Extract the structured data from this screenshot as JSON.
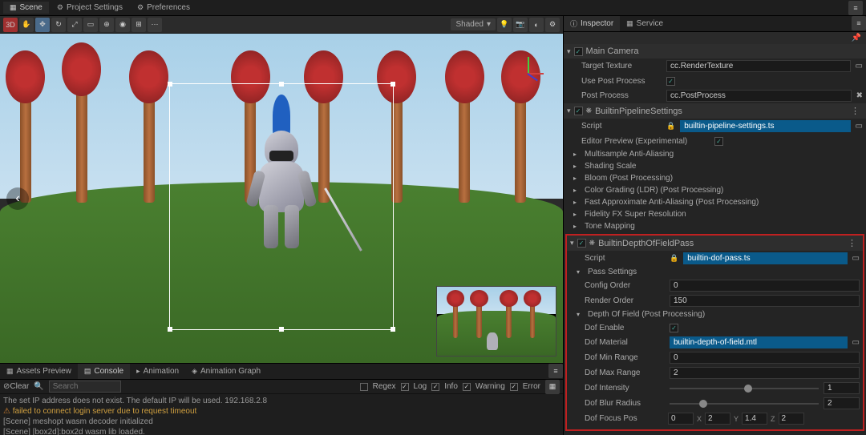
{
  "topTabs": {
    "scene": "Scene",
    "projectSettings": "Project Settings",
    "preferences": "Preferences"
  },
  "viewportToolbar": {
    "mode3d": "3D",
    "shaded": "Shaded"
  },
  "bottomTabs": {
    "assetsPreview": "Assets Preview",
    "console": "Console",
    "animation": "Animation",
    "animationGraph": "Animation Graph"
  },
  "consoleToolbar": {
    "clear": "Clear",
    "searchPlaceholder": "Search",
    "regex": "Regex",
    "log": "Log",
    "info": "Info",
    "warning": "Warning",
    "error": "Error"
  },
  "consoleLines": [
    {
      "type": "info",
      "text": "The set IP address does not exist. The default IP will be used. 192.168.2.8"
    },
    {
      "type": "warn",
      "text": "failed to connect login server due to request timeout"
    },
    {
      "type": "info",
      "text": "[Scene] meshopt wasm decoder initialized"
    },
    {
      "type": "info",
      "text": "[Scene] [box2d]:box2d wasm lib loaded."
    }
  ],
  "inspector": {
    "tabInspector": "Inspector",
    "tabService": "Service",
    "node": "Main Camera",
    "targetTextureLabel": "Target Texture",
    "targetTextureValue": "cc.RenderTexture",
    "usePostProcessLabel": "Use Post Process",
    "postProcessLabel": "Post Process",
    "postProcessValue": "cc.PostProcess",
    "builtinPipeline": {
      "title": "BuiltinPipelineSettings",
      "scriptLabel": "Script",
      "scriptValue": "builtin-pipeline-settings.ts",
      "editorPreviewLabel": "Editor Preview (Experimental)",
      "rows": [
        "Multisample Anti-Aliasing",
        "Shading Scale",
        "Bloom (Post Processing)",
        "Color Grading (LDR) (Post Processing)",
        "Fast Approximate Anti-Aliasing (Post Processing)",
        "Fidelity FX Super Resolution",
        "Tone Mapping"
      ]
    },
    "dofPass": {
      "title": "BuiltinDepthOfFieldPass",
      "scriptLabel": "Script",
      "scriptValue": "builtin-dof-pass.ts",
      "passSettingsLabel": "Pass Settings",
      "configOrderLabel": "Config Order",
      "configOrderValue": "0",
      "renderOrderLabel": "Render Order",
      "renderOrderValue": "150",
      "dofSectionLabel": "Depth Of Field (Post Processing)",
      "dofEnableLabel": "Dof Enable",
      "dofMaterialLabel": "Dof Material",
      "dofMaterialValue": "builtin-depth-of-field.mtl",
      "dofMinRangeLabel": "Dof Min Range",
      "dofMinRangeValue": "0",
      "dofMaxRangeLabel": "Dof Max Range",
      "dofMaxRangeValue": "2",
      "dofIntensityLabel": "Dof Intensity",
      "dofIntensityValue": "1",
      "dofBlurRadiusLabel": "Dof Blur Radius",
      "dofBlurRadiusValue": "2",
      "dofFocusPosLabel": "Dof Focus Pos",
      "dofFocusPosX": "0",
      "dofFocusPosY": "2",
      "dofFocusPosZ": "1.4",
      "dofFocusPosW": "2"
    }
  }
}
